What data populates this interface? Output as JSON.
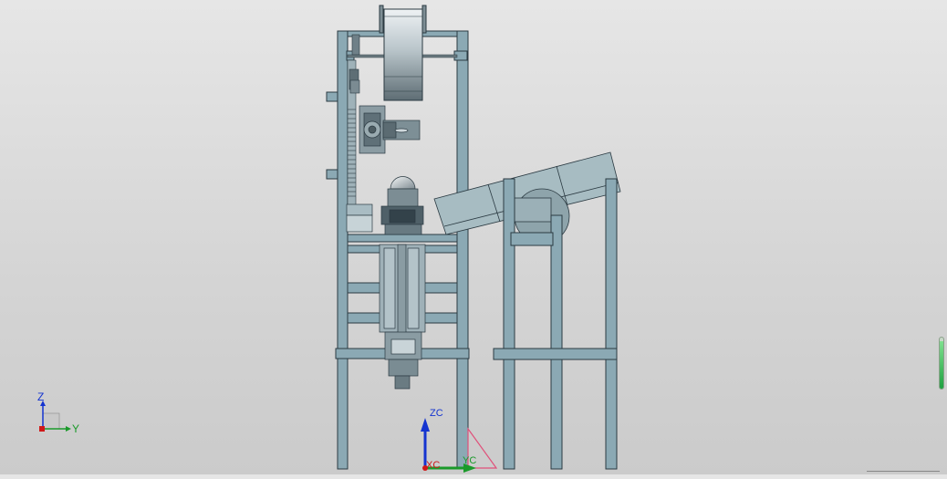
{
  "window": {
    "title": ""
  },
  "triad": {
    "x_label": "XC",
    "y_label": "YC",
    "z_label": "ZC"
  },
  "view_orientation": {
    "z_label": "Z",
    "y_label": "Y"
  },
  "zoom_indicator": {
    "level": 0.92
  },
  "colors": {
    "background": "#d9d9d9",
    "frame": "#8ba9b4",
    "frame_edge": "#2b3a42",
    "chute": "#a7bcc2",
    "drum": "#7a8c94",
    "axis_x": "#d01818",
    "axis_y": "#1a9a2a",
    "axis_z": "#1434d0",
    "work_plane": "#e0507a"
  }
}
